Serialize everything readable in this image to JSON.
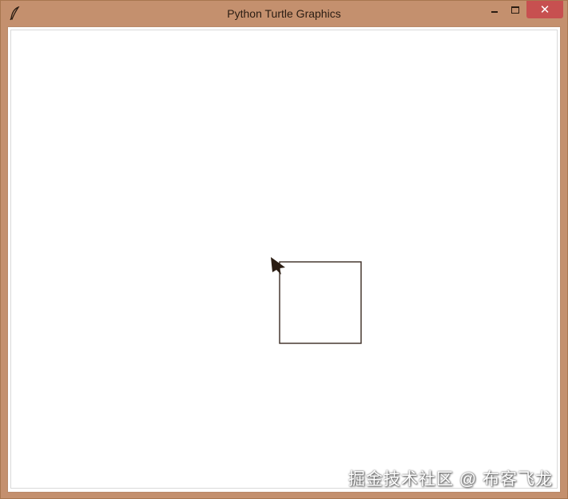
{
  "window": {
    "title": "Python Turtle Graphics",
    "close_glyph": "✕"
  },
  "icons": {
    "app": "feather-icon",
    "minimize": "minimize-icon",
    "maximize": "maximize-icon",
    "close": "close-icon",
    "turtle": "turtle-arrow-icon"
  },
  "colors": {
    "frame": "#c4906e",
    "close_button": "#c75050",
    "pen": "#3a2a22",
    "canvas": "#ffffff"
  },
  "watermark": {
    "text": "掘金技术社区 @ 布客飞龙"
  }
}
